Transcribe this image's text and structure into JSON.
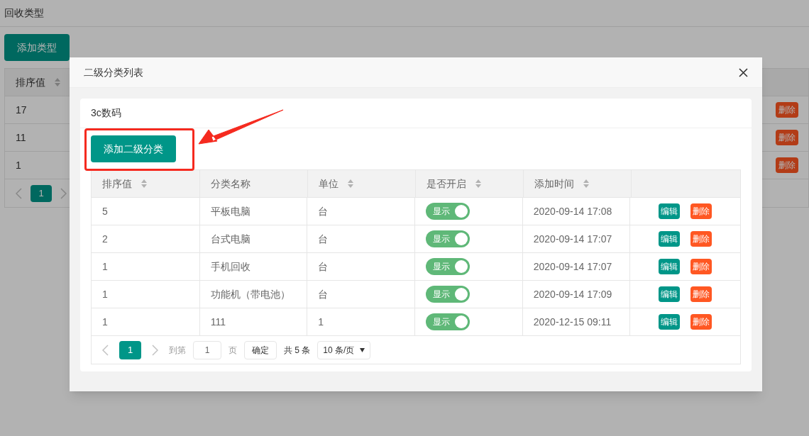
{
  "page": {
    "title": "回收类型",
    "add_button": "添加类型",
    "table": {
      "columns": [
        {
          "label": "排序值",
          "sortable": true
        }
      ],
      "rows": [
        {
          "sort": "17",
          "delete": "删除"
        },
        {
          "sort": "11",
          "delete": "删除"
        },
        {
          "sort": "1",
          "delete": "删除"
        }
      ]
    },
    "pagination": {
      "pages": [
        {
          "label": "1",
          "selected": true
        }
      ]
    }
  },
  "modal": {
    "title": "二级分类列表",
    "card_title": "3c数码",
    "add_button": "添加二级分类",
    "table": {
      "columns": [
        {
          "label": "排序值",
          "sortable": true
        },
        {
          "label": "分类名称",
          "sortable": false
        },
        {
          "label": "单位",
          "sortable": true
        },
        {
          "label": "是否开启",
          "sortable": true
        },
        {
          "label": "添加时间",
          "sortable": true
        }
      ],
      "rows": [
        {
          "sort": "5",
          "name": "平板电脑",
          "unit": "台",
          "switch": {
            "label": "显示",
            "on": true
          },
          "time": "2020-09-14 17:08",
          "edit": "编辑",
          "delete": "删除"
        },
        {
          "sort": "2",
          "name": "台式电脑",
          "unit": "台",
          "switch": {
            "label": "显示",
            "on": true
          },
          "time": "2020-09-14 17:07",
          "edit": "编辑",
          "delete": "删除"
        },
        {
          "sort": "1",
          "name": "手机回收",
          "unit": "台",
          "switch": {
            "label": "显示",
            "on": true
          },
          "time": "2020-09-14 17:07",
          "edit": "编辑",
          "delete": "删除"
        },
        {
          "sort": "1",
          "name": "功能机（带电池）",
          "unit": "台",
          "switch": {
            "label": "显示",
            "on": true
          },
          "time": "2020-09-14 17:09",
          "edit": "编辑",
          "delete": "删除"
        },
        {
          "sort": "1",
          "name": "111",
          "unit": "1",
          "switch": {
            "label": "显示",
            "on": true
          },
          "time": "2020-12-15 09:11",
          "edit": "编辑",
          "delete": "删除"
        }
      ]
    },
    "pagination": {
      "pages": [
        {
          "label": "1",
          "selected": true
        }
      ],
      "goto_label": "到第",
      "page_input": "1",
      "page_unit": "页",
      "confirm": "确定",
      "total": "共 5 条",
      "page_size": "10 条/页"
    }
  }
}
